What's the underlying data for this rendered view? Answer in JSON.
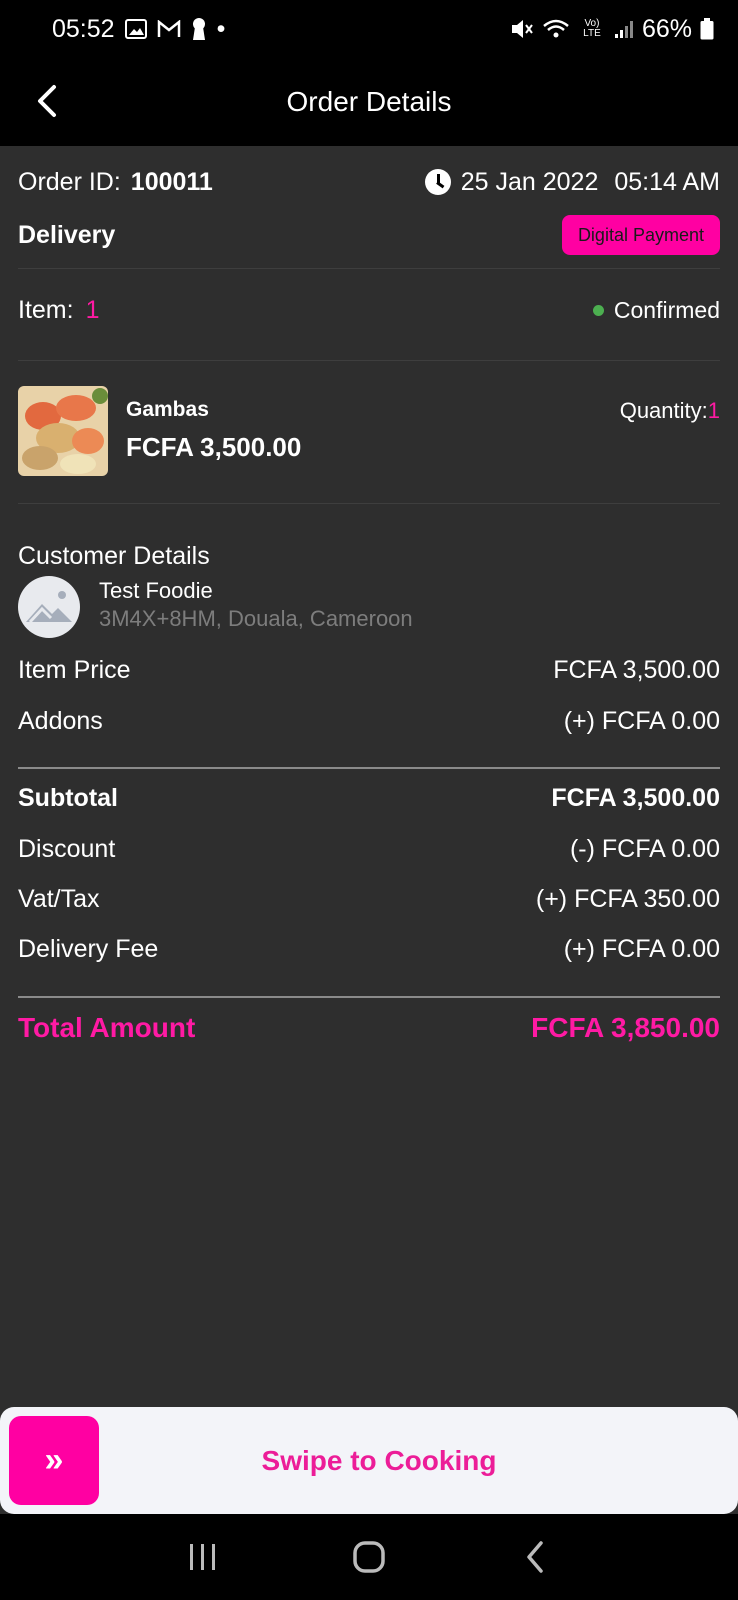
{
  "status_bar": {
    "time": "05:52",
    "battery": "66%",
    "dot": "•",
    "network": "Vo) LTE"
  },
  "header": {
    "title": "Order Details"
  },
  "order": {
    "id_label": "Order ID:",
    "id_value": "100011",
    "date": "25 Jan 2022",
    "time": "05:14 AM",
    "order_type": "Delivery",
    "payment_badge": "Digital Payment",
    "item_label": "Item:",
    "item_count": "1",
    "status": "Confirmed"
  },
  "product": {
    "name": "Gambas",
    "price": "FCFA 3,500.00",
    "quantity_label": "Quantity:",
    "quantity": "1"
  },
  "customer": {
    "section_title": "Customer Details",
    "name": "Test Foodie",
    "address": "3M4X+8HM, Douala, Cameroon"
  },
  "pricing": {
    "item_price_label": "Item Price",
    "item_price": "FCFA 3,500.00",
    "addons_label": "Addons",
    "addons": "(+) FCFA 0.00",
    "subtotal_label": "Subtotal",
    "subtotal": "FCFA 3,500.00",
    "discount_label": "Discount",
    "discount": "(-) FCFA 0.00",
    "tax_label": "Vat/Tax",
    "tax": "(+) FCFA 350.00",
    "delivery_fee_label": "Delivery Fee",
    "delivery_fee": "(+) FCFA 0.00",
    "total_label": "Total Amount",
    "total": "FCFA 3,850.00"
  },
  "swipe": {
    "handle_glyph": "»",
    "label": "Swipe to Cooking"
  },
  "colors": {
    "accent": "#ff00a2",
    "accent_text": "#ff1aa4",
    "background": "#2e2e2e",
    "status_green": "#4caf50"
  }
}
